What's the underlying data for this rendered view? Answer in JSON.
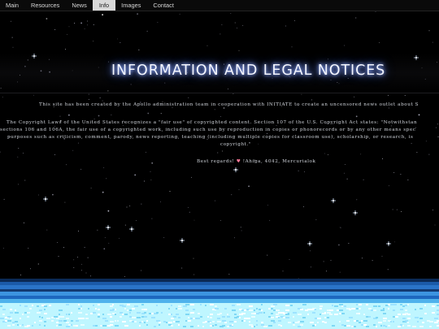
{
  "nav": {
    "items": [
      {
        "label": "Main"
      },
      {
        "label": "Resources"
      },
      {
        "label": "News"
      },
      {
        "label": "Info",
        "active": true
      },
      {
        "label": "Images"
      },
      {
        "label": "Contact"
      }
    ]
  },
  "main": {
    "title": "INFORMATION AND LEGAL NOTICES",
    "intro": "This site has been created by the Apollo administration team in cooperation with INITIATE to create an uncensored news outlet about S",
    "copyright_lines": [
      "The Copyright Laws of the United States recognizes a \"fair use\" of copyrighted content. Section 107 of the U.S. Copyright Act states: \"Notwithstan",
      "sections 106 and 106A, the fair use of a copyrighted work, including such use by reproduction in copies or phonorecords or by any other means spec",
      "purposes such as criticism, comment, parody, news reporting, teaching (including multiple copies for classroom use), scholarship, or research, is",
      "copyright.\""
    ],
    "signature_prefix": "Best regards! ",
    "signature_heart": "♥",
    "signature_suffix": " !Ahiga, 4042, Mercurialok"
  },
  "colors": {
    "background": "#000000",
    "title_glow": "#6d8cff",
    "nav_active_bg": "#d9d9d9",
    "band_blue": "#2a74c8",
    "band_cyan": "#9ff2ff"
  }
}
